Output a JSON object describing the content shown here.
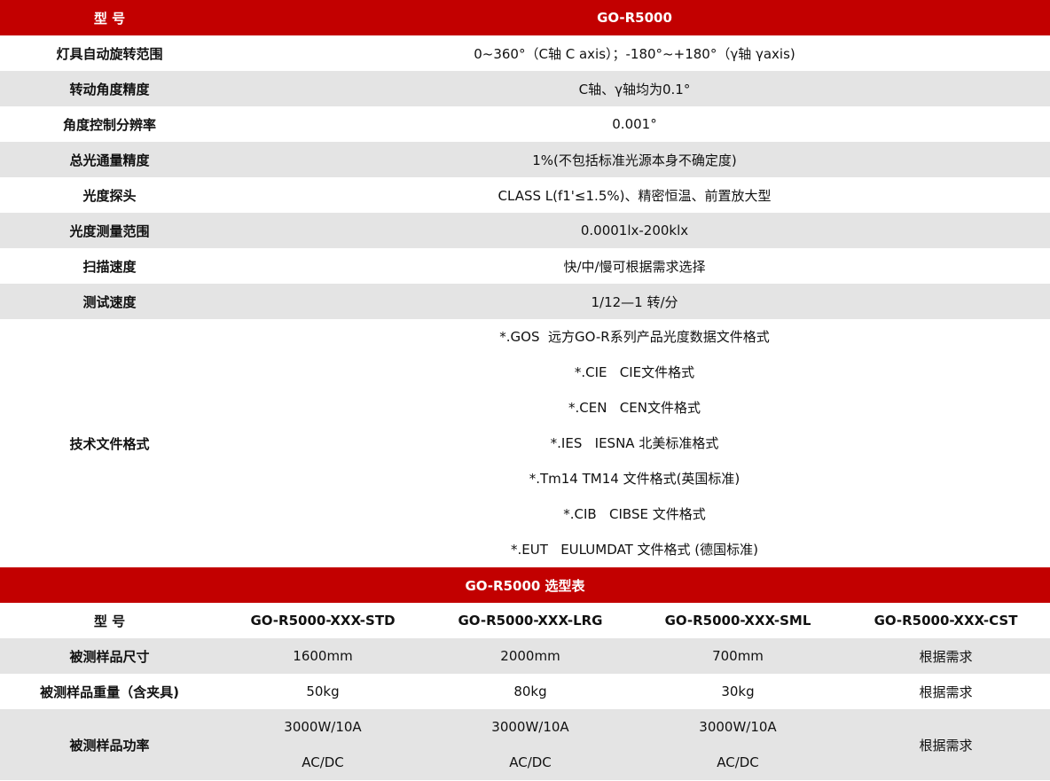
{
  "spec_table": {
    "header": {
      "label": "型 号",
      "value": "GO-R5000"
    },
    "rows": [
      {
        "label": "灯具自动旋转范围",
        "value": "0~360°（C轴 C axis）；-180°~+180°（γ轴 γaxis)"
      },
      {
        "label": "转动角度精度",
        "value": "C轴、γ轴均为0.1°"
      },
      {
        "label": "角度控制分辨率",
        "value": "0.001°"
      },
      {
        "label": "总光通量精度",
        "value": "1%(不包括标准光源本身不确定度)"
      },
      {
        "label": "光度探头",
        "value": "CLASS L(f1'≤1.5%)、精密恒温、前置放大型"
      },
      {
        "label": "光度测量范围",
        "value": "0.0001lx-200klx"
      },
      {
        "label": "扫描速度",
        "value": "快/中/慢可根据需求选择"
      },
      {
        "label": "测试速度",
        "value": "1/12—1 转/分"
      }
    ],
    "file_formats": {
      "label": "技术文件格式",
      "lines": [
        "*.GOS  远方GO-R系列产品光度数据文件格式",
        "*.CIE   CIE文件格式",
        "*.CEN   CEN文件格式",
        "*.IES   IESNA 北美标准格式",
        "*.Tm14 TM14 文件格式(英国标准)",
        "*.CIB   CIBSE 文件格式",
        "*.EUT   EULUMDAT 文件格式 (德国标准)"
      ]
    }
  },
  "selection_table": {
    "title": "GO-R5000 选型表",
    "header_label": "型 号",
    "models": [
      "GO-R5000-XXX-STD",
      "GO-R5000-XXX-LRG",
      "GO-R5000-XXX-SML",
      "GO-R5000-XXX-CST"
    ],
    "size": {
      "label": "被测样品尺寸",
      "values": [
        "1600mm",
        "2000mm",
        "700mm",
        "根据需求"
      ]
    },
    "weight": {
      "label": "被测样品重量（含夹具)",
      "values": [
        "50kg",
        "80kg",
        "30kg",
        "根据需求"
      ]
    },
    "power": {
      "label": "被测样品功率",
      "values": [
        {
          "watt": "3000W/10A",
          "type": "AC/DC"
        },
        {
          "watt": "3000W/10A",
          "type": "AC/DC"
        },
        {
          "watt": "3000W/10A",
          "type": "AC/DC"
        }
      ],
      "custom": "根据需求"
    }
  }
}
